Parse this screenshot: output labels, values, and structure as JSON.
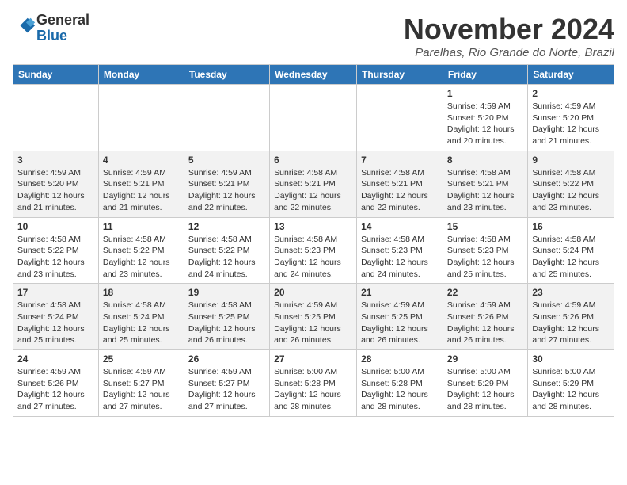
{
  "logo": {
    "general": "General",
    "blue": "Blue"
  },
  "header": {
    "title": "November 2024",
    "location": "Parelhas, Rio Grande do Norte, Brazil"
  },
  "days_of_week": [
    "Sunday",
    "Monday",
    "Tuesday",
    "Wednesday",
    "Thursday",
    "Friday",
    "Saturday"
  ],
  "weeks": [
    [
      {
        "day": "",
        "content": ""
      },
      {
        "day": "",
        "content": ""
      },
      {
        "day": "",
        "content": ""
      },
      {
        "day": "",
        "content": ""
      },
      {
        "day": "",
        "content": ""
      },
      {
        "day": "1",
        "content": "Sunrise: 4:59 AM\nSunset: 5:20 PM\nDaylight: 12 hours\nand 20 minutes."
      },
      {
        "day": "2",
        "content": "Sunrise: 4:59 AM\nSunset: 5:20 PM\nDaylight: 12 hours\nand 21 minutes."
      }
    ],
    [
      {
        "day": "3",
        "content": "Sunrise: 4:59 AM\nSunset: 5:20 PM\nDaylight: 12 hours\nand 21 minutes."
      },
      {
        "day": "4",
        "content": "Sunrise: 4:59 AM\nSunset: 5:21 PM\nDaylight: 12 hours\nand 21 minutes."
      },
      {
        "day": "5",
        "content": "Sunrise: 4:59 AM\nSunset: 5:21 PM\nDaylight: 12 hours\nand 22 minutes."
      },
      {
        "day": "6",
        "content": "Sunrise: 4:58 AM\nSunset: 5:21 PM\nDaylight: 12 hours\nand 22 minutes."
      },
      {
        "day": "7",
        "content": "Sunrise: 4:58 AM\nSunset: 5:21 PM\nDaylight: 12 hours\nand 22 minutes."
      },
      {
        "day": "8",
        "content": "Sunrise: 4:58 AM\nSunset: 5:21 PM\nDaylight: 12 hours\nand 23 minutes."
      },
      {
        "day": "9",
        "content": "Sunrise: 4:58 AM\nSunset: 5:22 PM\nDaylight: 12 hours\nand 23 minutes."
      }
    ],
    [
      {
        "day": "10",
        "content": "Sunrise: 4:58 AM\nSunset: 5:22 PM\nDaylight: 12 hours\nand 23 minutes."
      },
      {
        "day": "11",
        "content": "Sunrise: 4:58 AM\nSunset: 5:22 PM\nDaylight: 12 hours\nand 23 minutes."
      },
      {
        "day": "12",
        "content": "Sunrise: 4:58 AM\nSunset: 5:22 PM\nDaylight: 12 hours\nand 24 minutes."
      },
      {
        "day": "13",
        "content": "Sunrise: 4:58 AM\nSunset: 5:23 PM\nDaylight: 12 hours\nand 24 minutes."
      },
      {
        "day": "14",
        "content": "Sunrise: 4:58 AM\nSunset: 5:23 PM\nDaylight: 12 hours\nand 24 minutes."
      },
      {
        "day": "15",
        "content": "Sunrise: 4:58 AM\nSunset: 5:23 PM\nDaylight: 12 hours\nand 25 minutes."
      },
      {
        "day": "16",
        "content": "Sunrise: 4:58 AM\nSunset: 5:24 PM\nDaylight: 12 hours\nand 25 minutes."
      }
    ],
    [
      {
        "day": "17",
        "content": "Sunrise: 4:58 AM\nSunset: 5:24 PM\nDaylight: 12 hours\nand 25 minutes."
      },
      {
        "day": "18",
        "content": "Sunrise: 4:58 AM\nSunset: 5:24 PM\nDaylight: 12 hours\nand 25 minutes."
      },
      {
        "day": "19",
        "content": "Sunrise: 4:58 AM\nSunset: 5:25 PM\nDaylight: 12 hours\nand 26 minutes."
      },
      {
        "day": "20",
        "content": "Sunrise: 4:59 AM\nSunset: 5:25 PM\nDaylight: 12 hours\nand 26 minutes."
      },
      {
        "day": "21",
        "content": "Sunrise: 4:59 AM\nSunset: 5:25 PM\nDaylight: 12 hours\nand 26 minutes."
      },
      {
        "day": "22",
        "content": "Sunrise: 4:59 AM\nSunset: 5:26 PM\nDaylight: 12 hours\nand 26 minutes."
      },
      {
        "day": "23",
        "content": "Sunrise: 4:59 AM\nSunset: 5:26 PM\nDaylight: 12 hours\nand 27 minutes."
      }
    ],
    [
      {
        "day": "24",
        "content": "Sunrise: 4:59 AM\nSunset: 5:26 PM\nDaylight: 12 hours\nand 27 minutes."
      },
      {
        "day": "25",
        "content": "Sunrise: 4:59 AM\nSunset: 5:27 PM\nDaylight: 12 hours\nand 27 minutes."
      },
      {
        "day": "26",
        "content": "Sunrise: 4:59 AM\nSunset: 5:27 PM\nDaylight: 12 hours\nand 27 minutes."
      },
      {
        "day": "27",
        "content": "Sunrise: 5:00 AM\nSunset: 5:28 PM\nDaylight: 12 hours\nand 28 minutes."
      },
      {
        "day": "28",
        "content": "Sunrise: 5:00 AM\nSunset: 5:28 PM\nDaylight: 12 hours\nand 28 minutes."
      },
      {
        "day": "29",
        "content": "Sunrise: 5:00 AM\nSunset: 5:29 PM\nDaylight: 12 hours\nand 28 minutes."
      },
      {
        "day": "30",
        "content": "Sunrise: 5:00 AM\nSunset: 5:29 PM\nDaylight: 12 hours\nand 28 minutes."
      }
    ]
  ]
}
